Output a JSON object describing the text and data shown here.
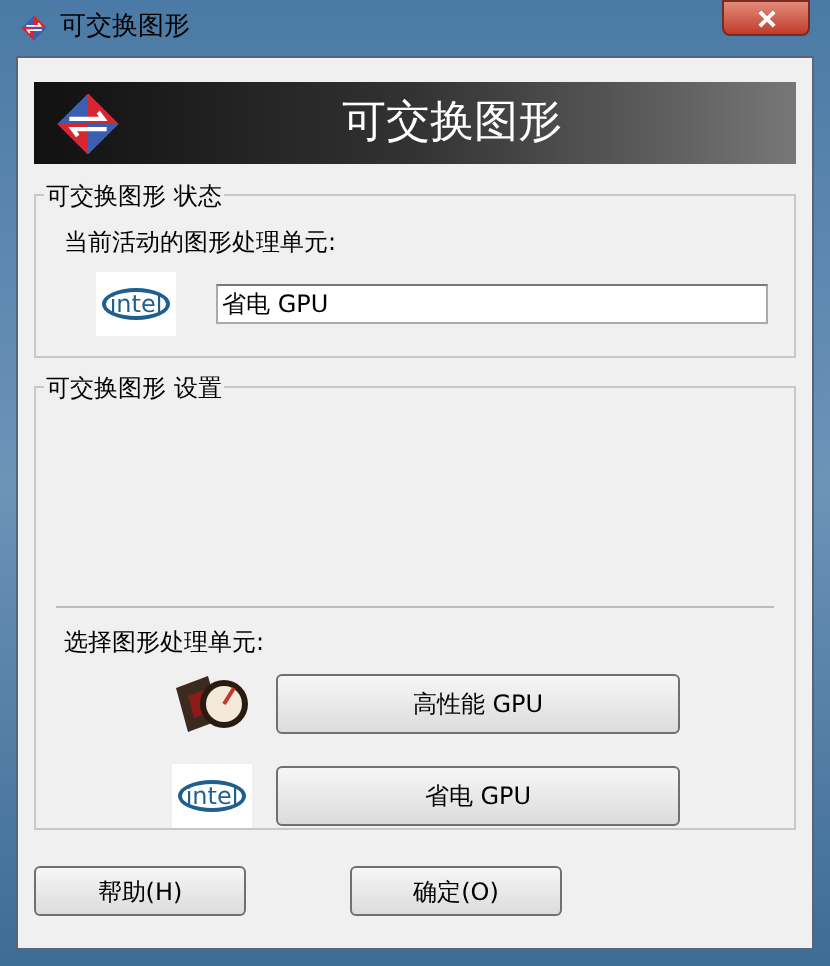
{
  "window": {
    "title": "可交换图形"
  },
  "banner": {
    "title": "可交换图形"
  },
  "status_group": {
    "title": "可交换图形 状态",
    "label": "当前活动的图形处理单元:",
    "logo_text": "intel",
    "value": "省电 GPU"
  },
  "settings_group": {
    "title": "可交换图形 设置",
    "label": "选择图形处理单元:",
    "options": [
      {
        "kind": "discrete",
        "label": "高性能 GPU"
      },
      {
        "kind": "integrated",
        "logo_text": "intel",
        "label": "省电 GPU"
      }
    ]
  },
  "buttons": [
    "帮助(H)",
    "确定(O)"
  ]
}
